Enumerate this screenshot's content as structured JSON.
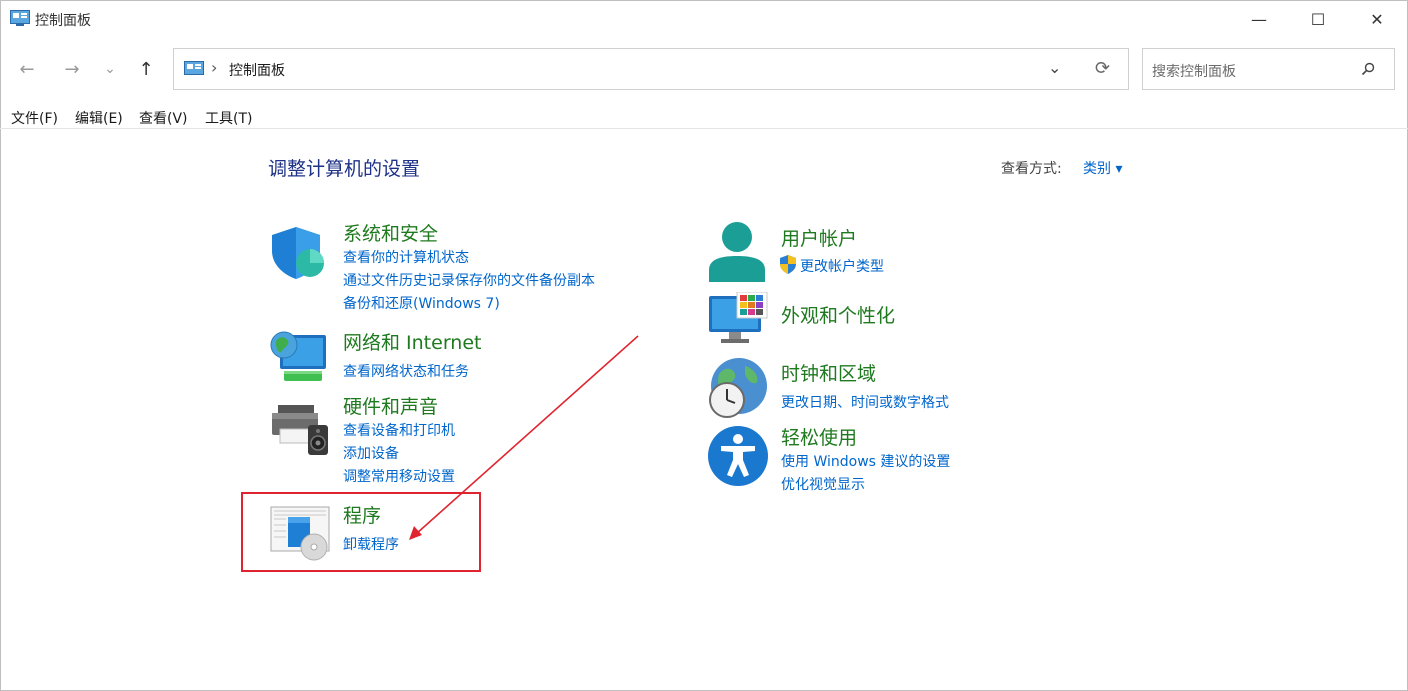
{
  "window": {
    "title": "控制面板",
    "minimize_glyph": "—",
    "maximize_glyph": "☐",
    "close_glyph": "✕"
  },
  "nav": {
    "back_glyph": "←",
    "forward_glyph": "→",
    "recent_glyph": "⌄",
    "up_glyph": "↑",
    "address_chevron": "›",
    "address_text": "控制面板",
    "dropdown_glyph": "⌄",
    "refresh_glyph": "⟳"
  },
  "search": {
    "placeholder": "搜索控制面板"
  },
  "menu": {
    "items": [
      "文件(F)",
      "编辑(E)",
      "查看(V)",
      "工具(T)"
    ]
  },
  "main": {
    "heading": "调整计算机的设置",
    "view_by_label": "查看方式:",
    "view_by_value": "类别 ▾",
    "categories": [
      {
        "title": "系统和安全",
        "icon": "shield-icon",
        "links": [
          "查看你的计算机状态",
          "通过文件历史记录保存你的文件备份副本",
          "备份和还原(Windows 7)"
        ]
      },
      {
        "title": "网络和 Internet",
        "icon": "network-globe-icon",
        "links": [
          "查看网络状态和任务"
        ]
      },
      {
        "title": "硬件和声音",
        "icon": "printer-speaker-icon",
        "links": [
          "查看设备和打印机",
          "添加设备",
          "调整常用移动设置"
        ]
      },
      {
        "title": "程序",
        "icon": "programs-disc-icon",
        "links": [
          "卸载程序"
        ]
      },
      {
        "title": "用户帐户",
        "icon": "user-icon",
        "links": [
          "更改帐户类型"
        ]
      },
      {
        "title": "外观和个性化",
        "icon": "monitor-palette-icon",
        "links": []
      },
      {
        "title": "时钟和区域",
        "icon": "globe-clock-icon",
        "links": [
          "更改日期、时间或数字格式"
        ]
      },
      {
        "title": "轻松使用",
        "icon": "accessibility-icon",
        "links": [
          "使用 Windows 建议的设置",
          "优化视觉显示"
        ]
      }
    ]
  },
  "colors": {
    "category_title": "#1f7a1f",
    "link": "#0066cc",
    "heading": "#1e3287",
    "annotation_red": "#e0242f"
  }
}
